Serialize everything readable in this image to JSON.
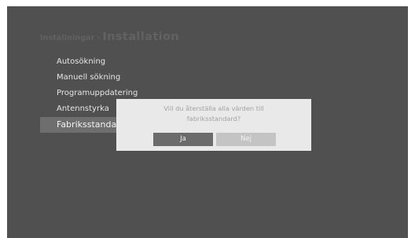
{
  "breadcrumb": {
    "parent": "Inställningar",
    "separator": "›",
    "current": "Installation"
  },
  "menu": {
    "items": [
      {
        "label": "Autosökning"
      },
      {
        "label": "Manuell sökning"
      },
      {
        "label": "Programuppdatering"
      },
      {
        "label": "Antennstyrka"
      },
      {
        "label": "Fabriksstandard",
        "selected": true
      }
    ]
  },
  "dialog": {
    "message_line1": "Vill du återställa alla värden till",
    "message_line2": "fabriksstandard?",
    "yes_label": "Ja",
    "no_label": "Nej",
    "focused_button": "Ja"
  },
  "colors": {
    "screen_background": "#505050",
    "selected_row": "#6e6e6e",
    "dialog_background": "#e9e9e9",
    "focused_button": "#6b6b6b",
    "unfocused_button": "#c4c4c4"
  }
}
